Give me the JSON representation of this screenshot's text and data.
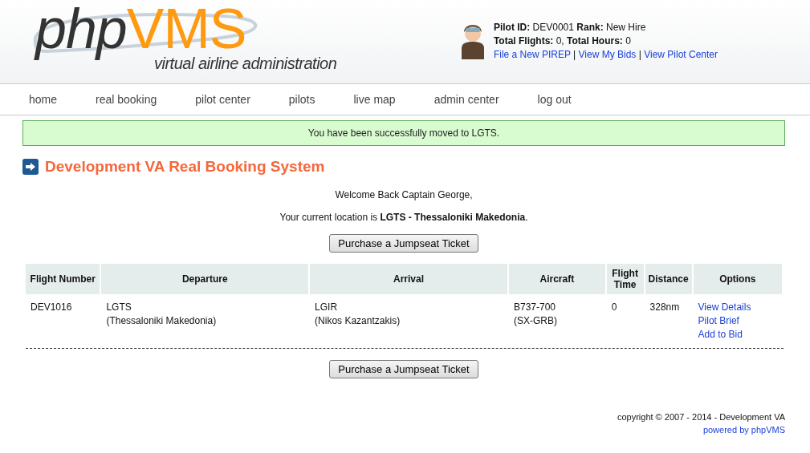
{
  "logo": {
    "php": "php",
    "vms": "VMS",
    "tagline": "virtual airline administration"
  },
  "pilot": {
    "line1": "**Pilot ID:** DEV0001 **Rank:** New Hire",
    "line2": "**Total Flights:** 0, **Total Hours:** 0",
    "links": [
      "File a New PIREP",
      "View My Bids",
      "View Pilot Center"
    ],
    "separator": "|"
  },
  "nav": [
    "home",
    "real booking",
    "pilot center",
    "pilots",
    "live map",
    "admin center",
    "log out"
  ],
  "message": "You have been successfully moved to LGTS.",
  "heading": "Development VA Real Booking System",
  "welcome": "Welcome Back Captain George,",
  "location": "Your current location is **LGTS - Thessaloniki Makedonia**.",
  "jumpseat_buttons": [
    "Purchase a Jumpseat Ticket",
    "Purchase a Jumpseat Ticket"
  ],
  "table": {
    "columns": [
      "Flight Number",
      "Departure",
      "Arrival",
      "Aircraft",
      "Flight Time",
      "Distance",
      "Options"
    ],
    "rows": [
      {
        "flight_number": "DEV1016",
        "departure": [
          "LGTS",
          "(Thessaloniki Makedonia)"
        ],
        "arrival": [
          "LGIR",
          "(Nikos Kazantzakis)"
        ],
        "aircraft": [
          "B737-700",
          "(SX-GRB)"
        ],
        "flight_time": "0",
        "distance": "328nm",
        "options": [
          "View Details",
          "Pilot Brief",
          "Add to Bid"
        ]
      }
    ]
  },
  "footer": {
    "copyright": "copyright © 2007 - 2014 - Development VA",
    "powered": "powered by phpVMS"
  }
}
